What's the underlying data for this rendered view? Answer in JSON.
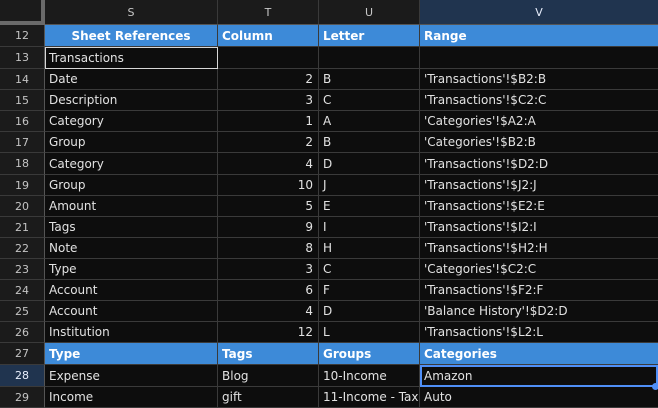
{
  "columns": [
    "S",
    "T",
    "U",
    "V"
  ],
  "section_header": {
    "row": "12",
    "cells": [
      "Sheet References",
      "Column",
      "Letter",
      "Range"
    ]
  },
  "title_row": {
    "row": "13",
    "value": "Transactions"
  },
  "rows": [
    {
      "row": "14",
      "s": "Date",
      "t": "2",
      "u": "B",
      "v": "'Transactions'!$B2:B"
    },
    {
      "row": "15",
      "s": "Description",
      "t": "3",
      "u": "C",
      "v": "'Transactions'!$C2:C"
    },
    {
      "row": "16",
      "s": "Category",
      "t": "1",
      "u": "A",
      "v": "'Categories'!$A2:A"
    },
    {
      "row": "17",
      "s": "Group",
      "t": "2",
      "u": "B",
      "v": "'Categories'!$B2:B"
    },
    {
      "row": "18",
      "s": "Category",
      "t": "4",
      "u": "D",
      "v": "'Transactions'!$D2:D"
    },
    {
      "row": "19",
      "s": "Group",
      "t": "10",
      "u": "J",
      "v": "'Transactions'!$J2:J"
    },
    {
      "row": "20",
      "s": "Amount",
      "t": "5",
      "u": "E",
      "v": "'Transactions'!$E2:E"
    },
    {
      "row": "21",
      "s": "Tags",
      "t": "9",
      "u": "I",
      "v": "'Transactions'!$I2:I"
    },
    {
      "row": "22",
      "s": "Note",
      "t": "8",
      "u": "H",
      "v": "'Transactions'!$H2:H"
    },
    {
      "row": "23",
      "s": "Type",
      "t": "3",
      "u": "C",
      "v": "'Categories'!$C2:C"
    },
    {
      "row": "24",
      "s": "Account",
      "t": "6",
      "u": "F",
      "v": "'Transactions'!$F2:F"
    },
    {
      "row": "25",
      "s": "Account",
      "t": "4",
      "u": "D",
      "v": "'Balance History'!$D2:D"
    },
    {
      "row": "26",
      "s": "Institution",
      "t": "12",
      "u": "L",
      "v": "'Transactions'!$L2:L"
    }
  ],
  "list_header": {
    "row": "27",
    "cells": [
      "Type",
      "Tags",
      "Groups",
      "Categories"
    ]
  },
  "list_rows": [
    {
      "row": "28",
      "s": "Expense",
      "t": "Blog",
      "u": "10-Income",
      "v": "Amazon"
    },
    {
      "row": "29",
      "s": "Income",
      "t": "gift",
      "u": "11-Income - Tax",
      "v": "Auto"
    }
  ],
  "colors": {
    "header_bg": "#3d8ad8",
    "selection": "#4f8ff7",
    "sheet_bg": "#0d0d0d"
  }
}
